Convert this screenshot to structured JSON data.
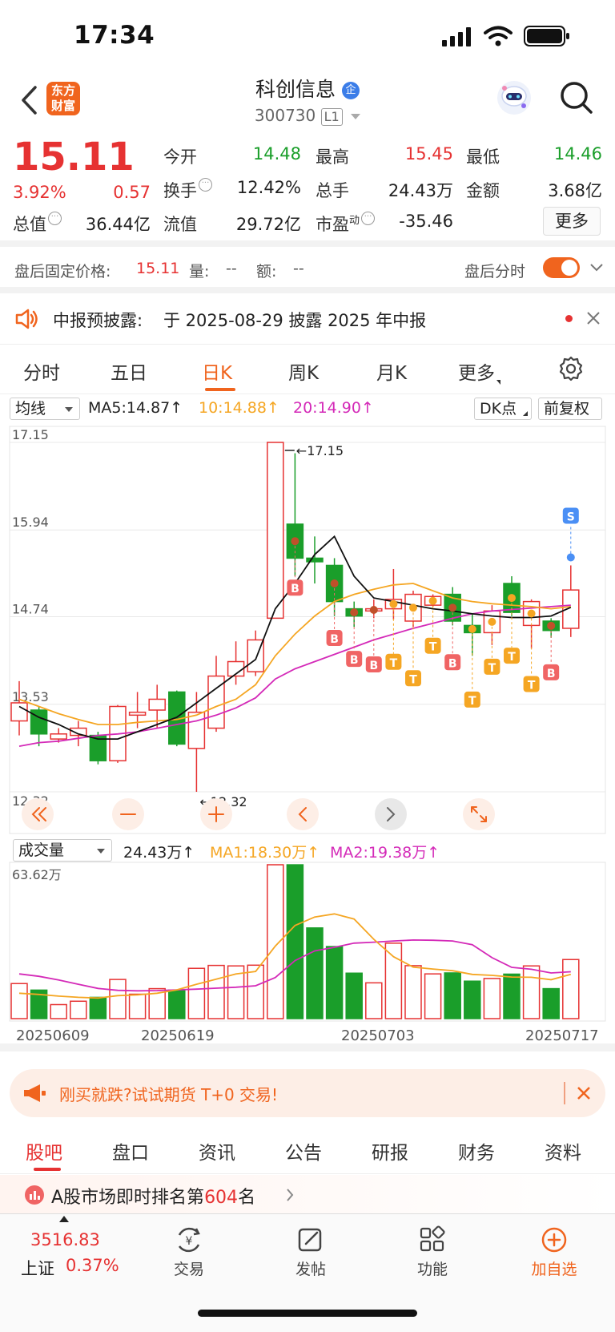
{
  "status": {
    "time": "17:34"
  },
  "header": {
    "logo_line1": "东方",
    "logo_line2": "财富",
    "name": "科创信息",
    "name_badge": "企",
    "code": "300730",
    "level": "L1"
  },
  "quote": {
    "price": "15.11",
    "change_pct": "3.92%",
    "change": "0.57",
    "rows": [
      [
        {
          "label": "今开",
          "value": "14.48",
          "color": "green"
        },
        {
          "label": "最高",
          "value": "15.45",
          "color": "red"
        },
        {
          "label": "最低",
          "value": "14.46",
          "color": "green"
        }
      ],
      [
        {
          "label": "换手",
          "value": "12.42%",
          "color": "dark"
        },
        {
          "label": "总手",
          "value": "24.43万",
          "color": "dark"
        },
        {
          "label": "金额",
          "value": "3.68亿",
          "color": "dark"
        }
      ],
      [
        {
          "label": "总值",
          "value": "36.44亿",
          "color": "dark"
        },
        {
          "label": "流值",
          "value": "29.72亿",
          "color": "dark"
        },
        {
          "label": "市盈",
          "label_sup": "动",
          "value": "-35.46",
          "color": "dark"
        }
      ]
    ],
    "more": "更多"
  },
  "after_hours": {
    "label": "盘后固定价格:",
    "price": "15.11",
    "vol_label": "量:",
    "vol": "--",
    "amt_label": "额:",
    "amt": "--",
    "switch_label": "盘后分时"
  },
  "notice": {
    "label": "中报预披露:",
    "text": "于 2025-08-29 披露 2025 年中报"
  },
  "tabs": [
    "分时",
    "五日",
    "日K",
    "周K",
    "月K",
    "更多"
  ],
  "ma": {
    "selector": "均线",
    "ma5": "MA5:14.87↑",
    "ma10": "10:14.88↑",
    "ma20": "20:14.90↑",
    "dk": "DK点",
    "adjust": "前复权"
  },
  "chart_data": {
    "type": "candlestick",
    "y_ticks": [
      "17.15",
      "15.94",
      "14.74",
      "13.53",
      "12.32"
    ],
    "ylim": [
      12.32,
      17.15
    ],
    "high_label": "17.15",
    "low_label": "12.32",
    "candles": [
      {
        "o": 13.3,
        "c": 13.55,
        "h": 13.85,
        "l": 13.1
      },
      {
        "o": 13.45,
        "c": 13.12,
        "h": 13.5,
        "l": 12.95
      },
      {
        "o": 13.05,
        "c": 13.12,
        "h": 13.2,
        "l": 13.0
      },
      {
        "o": 13.1,
        "c": 13.2,
        "h": 13.3,
        "l": 12.95
      },
      {
        "o": 13.1,
        "c": 12.75,
        "h": 13.15,
        "l": 12.7
      },
      {
        "o": 12.75,
        "c": 13.5,
        "h": 13.52,
        "l": 12.72
      },
      {
        "o": 13.38,
        "c": 13.42,
        "h": 13.7,
        "l": 13.2
      },
      {
        "o": 13.45,
        "c": 13.6,
        "h": 13.8,
        "l": 13.2
      },
      {
        "o": 13.7,
        "c": 12.98,
        "h": 13.72,
        "l": 12.95
      },
      {
        "o": 12.92,
        "c": 13.42,
        "h": 13.7,
        "l": 12.32
      },
      {
        "o": 13.2,
        "c": 13.92,
        "h": 14.2,
        "l": 13.15
      },
      {
        "o": 13.92,
        "c": 14.12,
        "h": 14.4,
        "l": 13.8
      },
      {
        "o": 13.98,
        "c": 14.42,
        "h": 14.55,
        "l": 13.92
      },
      {
        "o": 14.72,
        "c": 17.15,
        "h": 17.15,
        "l": 14.72
      },
      {
        "o": 16.02,
        "c": 15.55,
        "h": 17.0,
        "l": 15.3
      },
      {
        "o": 15.55,
        "c": 15.5,
        "h": 15.85,
        "l": 15.2
      },
      {
        "o": 15.45,
        "c": 14.95,
        "h": 15.55,
        "l": 14.75
      },
      {
        "o": 14.85,
        "c": 14.75,
        "h": 14.95,
        "l": 14.6
      },
      {
        "o": 14.82,
        "c": 14.85,
        "h": 14.98,
        "l": 14.72
      },
      {
        "o": 14.85,
        "c": 14.98,
        "h": 15.4,
        "l": 14.7
      },
      {
        "o": 14.68,
        "c": 15.05,
        "h": 15.1,
        "l": 14.6
      },
      {
        "o": 14.9,
        "c": 15.02,
        "h": 15.05,
        "l": 14.88
      },
      {
        "o": 15.05,
        "c": 14.68,
        "h": 15.15,
        "l": 14.62
      },
      {
        "o": 14.62,
        "c": 14.52,
        "h": 14.78,
        "l": 14.2
      },
      {
        "o": 14.52,
        "c": 14.82,
        "h": 14.9,
        "l": 14.35
      },
      {
        "o": 15.2,
        "c": 14.8,
        "h": 15.3,
        "l": 14.75
      },
      {
        "o": 14.62,
        "c": 14.95,
        "h": 14.98,
        "l": 14.3
      },
      {
        "o": 14.68,
        "c": 14.55,
        "h": 14.72,
        "l": 14.45
      },
      {
        "o": 14.58,
        "c": 15.11,
        "h": 15.45,
        "l": 14.46
      }
    ],
    "ma5": [
      13.5,
      13.35,
      13.25,
      13.12,
      13.05,
      13.05,
      13.15,
      13.25,
      13.35,
      13.55,
      13.75,
      13.95,
      14.15,
      14.85,
      15.2,
      15.6,
      15.85,
      15.3,
      15.0,
      14.95,
      14.9,
      14.85,
      14.82,
      14.78,
      14.75,
      14.73,
      14.73,
      14.75,
      14.87
    ],
    "ma10": [
      13.6,
      13.5,
      13.4,
      13.32,
      13.25,
      13.25,
      13.28,
      13.3,
      13.32,
      13.38,
      13.5,
      13.6,
      13.8,
      14.2,
      14.5,
      14.75,
      14.95,
      15.05,
      15.12,
      15.18,
      15.2,
      15.1,
      15.0,
      14.95,
      14.92,
      14.9,
      14.88,
      14.85,
      14.88
    ],
    "ma20": [
      12.95,
      13.0,
      13.02,
      13.06,
      13.1,
      13.12,
      13.15,
      13.2,
      13.25,
      13.3,
      13.38,
      13.48,
      13.62,
      13.88,
      14.02,
      14.12,
      14.22,
      14.32,
      14.42,
      14.5,
      14.58,
      14.65,
      14.72,
      14.78,
      14.82,
      14.84,
      14.86,
      14.88,
      14.9
    ],
    "signals": [
      {
        "i": 14,
        "tag": "B",
        "kind": "buy"
      },
      {
        "i": 16,
        "tag": "B",
        "kind": "buy"
      },
      {
        "i": 17,
        "tag": "B",
        "kind": "buy"
      },
      {
        "i": 18,
        "tag": "B",
        "kind": "buy"
      },
      {
        "i": 19,
        "tag": "T",
        "kind": "t"
      },
      {
        "i": 20,
        "tag": "T",
        "kind": "t"
      },
      {
        "i": 21,
        "tag": "T",
        "kind": "t"
      },
      {
        "i": 22,
        "tag": "B",
        "kind": "buy"
      },
      {
        "i": 23,
        "tag": "T",
        "kind": "t"
      },
      {
        "i": 24,
        "tag": "T",
        "kind": "t"
      },
      {
        "i": 25,
        "tag": "T",
        "kind": "t"
      },
      {
        "i": 26,
        "tag": "T",
        "kind": "t"
      },
      {
        "i": 27,
        "tag": "B",
        "kind": "buy"
      },
      {
        "i": 28,
        "tag": "S",
        "kind": "sell"
      }
    ],
    "volume": {
      "selector": "成交量",
      "value": "24.43万↑",
      "ma1": "MA1:18.30万↑",
      "ma2": "MA2:19.38万↑",
      "max_label": "63.62万",
      "max": 63.62,
      "values": [
        14.5,
        11.8,
        5.8,
        7.2,
        8.8,
        16.2,
        10.1,
        12.4,
        11.8,
        20.8,
        22.0,
        21.8,
        22.1,
        63.62,
        63.6,
        37.5,
        29.8,
        18.8,
        14.8,
        31.2,
        21.9,
        18.5,
        18.9,
        15.5,
        16.6,
        18.4,
        21.8,
        12.4,
        24.43
      ],
      "ma1_vals": [
        10.5,
        10,
        9.3,
        8.8,
        8.5,
        9.5,
        9.8,
        10.5,
        11.9,
        14.2,
        16.3,
        18.5,
        19.5,
        30,
        38.5,
        42,
        43.3,
        41.2,
        32.8,
        25.6,
        21.3,
        20.5,
        19.8,
        18.3,
        17.9,
        17.2,
        17.1,
        16.1,
        18.3
      ],
      "ma2_vals": [
        18.5,
        17.5,
        16,
        14.2,
        12.5,
        11.7,
        11.5,
        11.6,
        11.9,
        12.2,
        12.6,
        13,
        13.6,
        17,
        24,
        28,
        29.5,
        31.2,
        31.6,
        32.1,
        32.5,
        32.4,
        32.1,
        30.6,
        25.2,
        21.2,
        20.4,
        18.9,
        19.38
      ]
    },
    "dates": [
      "20250609",
      "20250619",
      "20250703",
      "20250717"
    ]
  },
  "promo": {
    "text": "刚买就跌?试试期货 T+0 交易!"
  },
  "bottom_tabs": [
    "股吧",
    "盘口",
    "资讯",
    "公告",
    "研报",
    "财务",
    "资料"
  ],
  "rank": {
    "prefix": "A股市场即时排名第",
    "rank": "604",
    "suffix": "名"
  },
  "dock": {
    "index_value": "3516.83",
    "index_name": "上证",
    "index_change": "0.37%",
    "trade": "交易",
    "post": "发帖",
    "func": "功能",
    "add": "加自选"
  }
}
